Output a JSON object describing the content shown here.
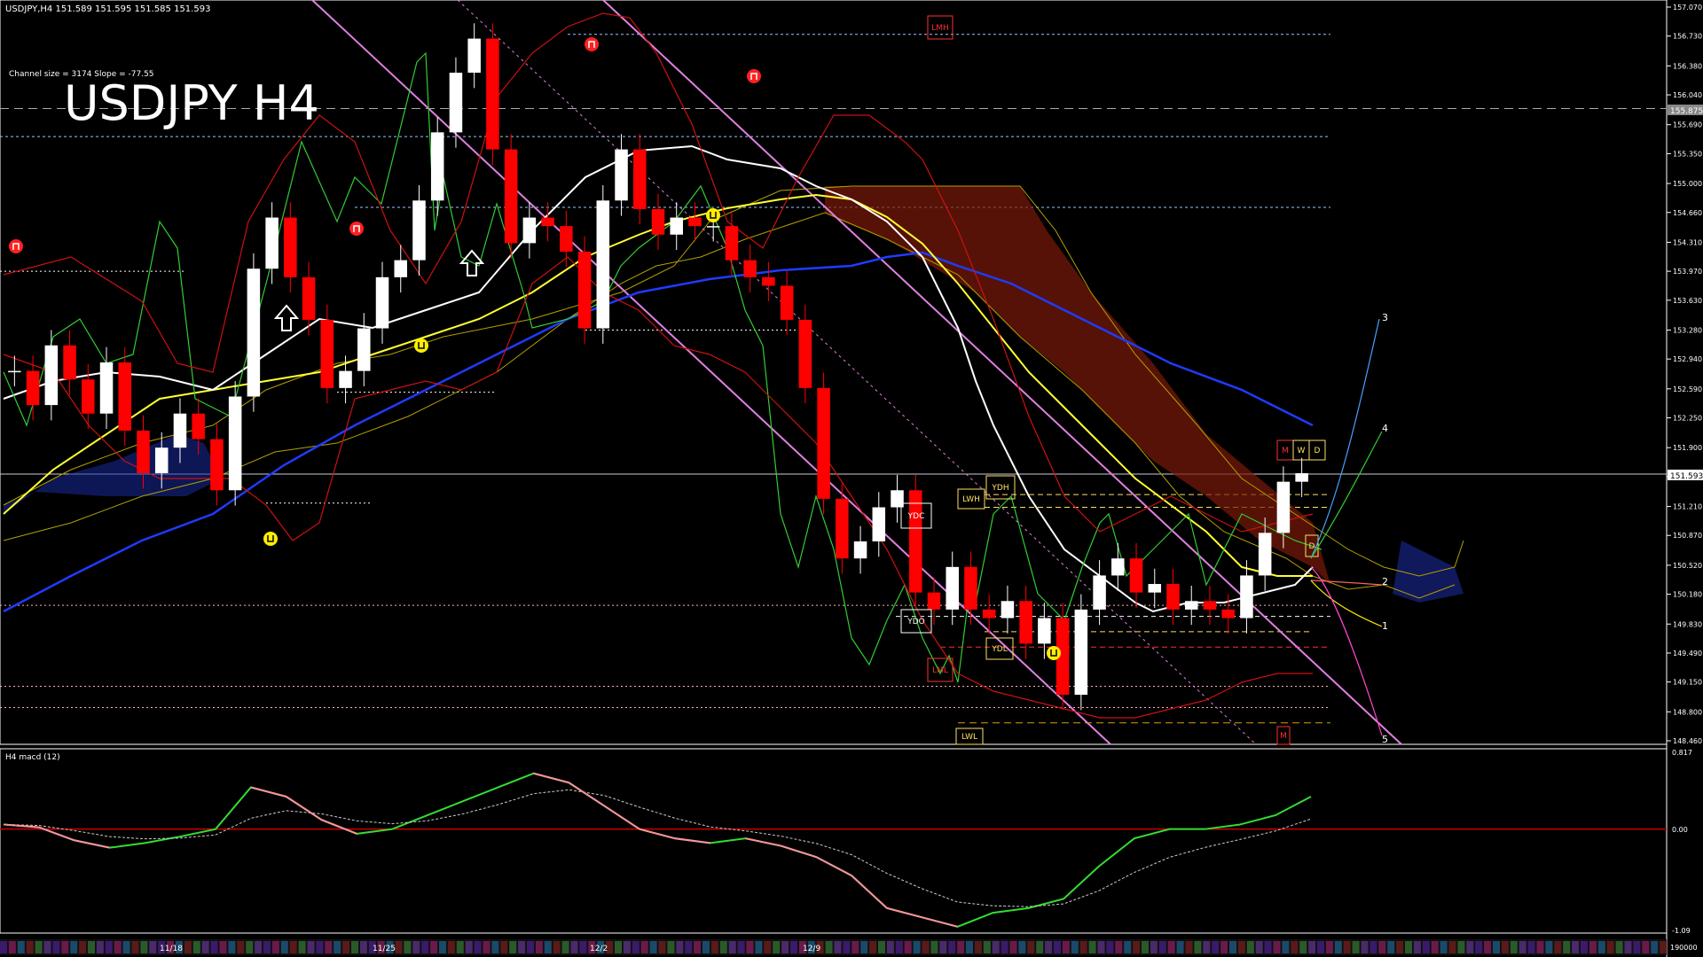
{
  "header": {
    "symbol_line": "USDJPY,H4",
    "ohlc": "151.589 151.595 151.585 151.593",
    "channel_info": "Channel size = 3174 Slope = -77.55",
    "big_title": "USDJPY H4"
  },
  "colors": {
    "background": "#000000",
    "candle_up": "#ffffff",
    "candle_down": "#ff0000",
    "ma_white": "#ffffff",
    "ma_yellow": "#ffff33",
    "ma_blue": "#1f3bff",
    "channel": "#e080e0",
    "green_line": "#33cc33",
    "bollinger": "#cc1111",
    "ichimoku_edge": "#b3a000",
    "macd_main": "#33dd33",
    "macd_neg": "#ff8fa0",
    "macd_signal": "#cccccc",
    "forecast_blue": "#4aa0ff"
  },
  "price_axis": {
    "ticks": [
      "157.070",
      "156.730",
      "156.380",
      "156.040",
      "155.690",
      "155.350",
      "155.000",
      "154.660",
      "154.310",
      "153.970",
      "153.630",
      "153.280",
      "152.940",
      "152.590",
      "152.250",
      "151.900",
      "151.560",
      "151.210",
      "150.870",
      "150.520",
      "150.180",
      "149.830",
      "149.490",
      "149.150",
      "148.800",
      "148.460"
    ],
    "current_price_label": "151.593",
    "marked_label": "155.875"
  },
  "time_axis": {
    "labels": [
      "11/18",
      "11/25",
      "12/2",
      "12/9"
    ]
  },
  "level_labels": {
    "lmh": "LMH",
    "lml": "LML",
    "ydc": "YDC",
    "ydo": "YDO",
    "ydh": "YDH",
    "ydl": "YDL",
    "lwh": "LWH",
    "lwl": "LWL",
    "m_top": "M",
    "w_top": "W",
    "d_top": "D",
    "d_mid": "D",
    "m_bot": "M"
  },
  "forecast_labels": [
    "3",
    "4",
    "2",
    "1",
    "5"
  ],
  "macd_panel": {
    "title": "H4 macd (12)",
    "ticks": [
      "0.817",
      "0.00",
      "-1.09"
    ],
    "volume_label": "190000"
  },
  "chart_data": [
    {
      "type": "line",
      "title": "USDJPY H4",
      "ylim": [
        148.46,
        157.07
      ],
      "series": [
        {
          "name": "",
          "values": [
            152.8,
            152.4,
            153.1,
            152.7,
            152.3,
            152.9,
            152.1,
            151.6,
            151.9,
            152.3,
            152.0,
            151.4,
            152.5,
            154.0,
            154.6,
            153.9,
            153.4,
            152.6,
            152.8,
            153.3,
            153.9,
            154.1,
            154.8,
            155.6,
            156.3,
            156.7,
            155.4,
            154.3,
            154.6,
            154.5,
            154.2,
            153.3,
            154.8,
            155.4,
            154.7,
            154.4,
            154.6,
            154.5,
            154.5,
            154.1,
            153.9,
            153.8,
            153.4,
            152.6,
            151.3,
            150.6,
            150.8,
            151.2,
            151.4,
            150.2,
            150.0,
            150.5,
            150.0,
            149.9,
            150.1,
            149.6,
            149.9,
            149.0,
            150.0,
            150.4,
            150.6,
            150.2,
            150.3,
            150.0,
            150.1,
            150.0,
            149.9,
            150.4,
            150.9,
            151.5,
            151.6
          ]
        }
      ]
    },
    {
      "type": "line",
      "title": "H4 macd (12)",
      "ylim": [
        -1.09,
        0.817
      ],
      "series": [
        {
          "name": "",
          "values": [
            0.05,
            0.02,
            -0.12,
            -0.2,
            -0.15,
            -0.08,
            0.0,
            0.45,
            0.35,
            0.1,
            -0.05,
            0.0,
            0.15,
            0.3,
            0.45,
            0.6,
            0.5,
            0.25,
            0.0,
            -0.1,
            -0.15,
            -0.1,
            -0.18,
            -0.3,
            -0.5,
            -0.85,
            -0.95,
            -1.05,
            -0.9,
            -0.85,
            -0.75,
            -0.4,
            -0.1,
            0.0,
            0.0,
            0.05,
            0.15,
            0.35
          ]
        }
      ]
    }
  ]
}
